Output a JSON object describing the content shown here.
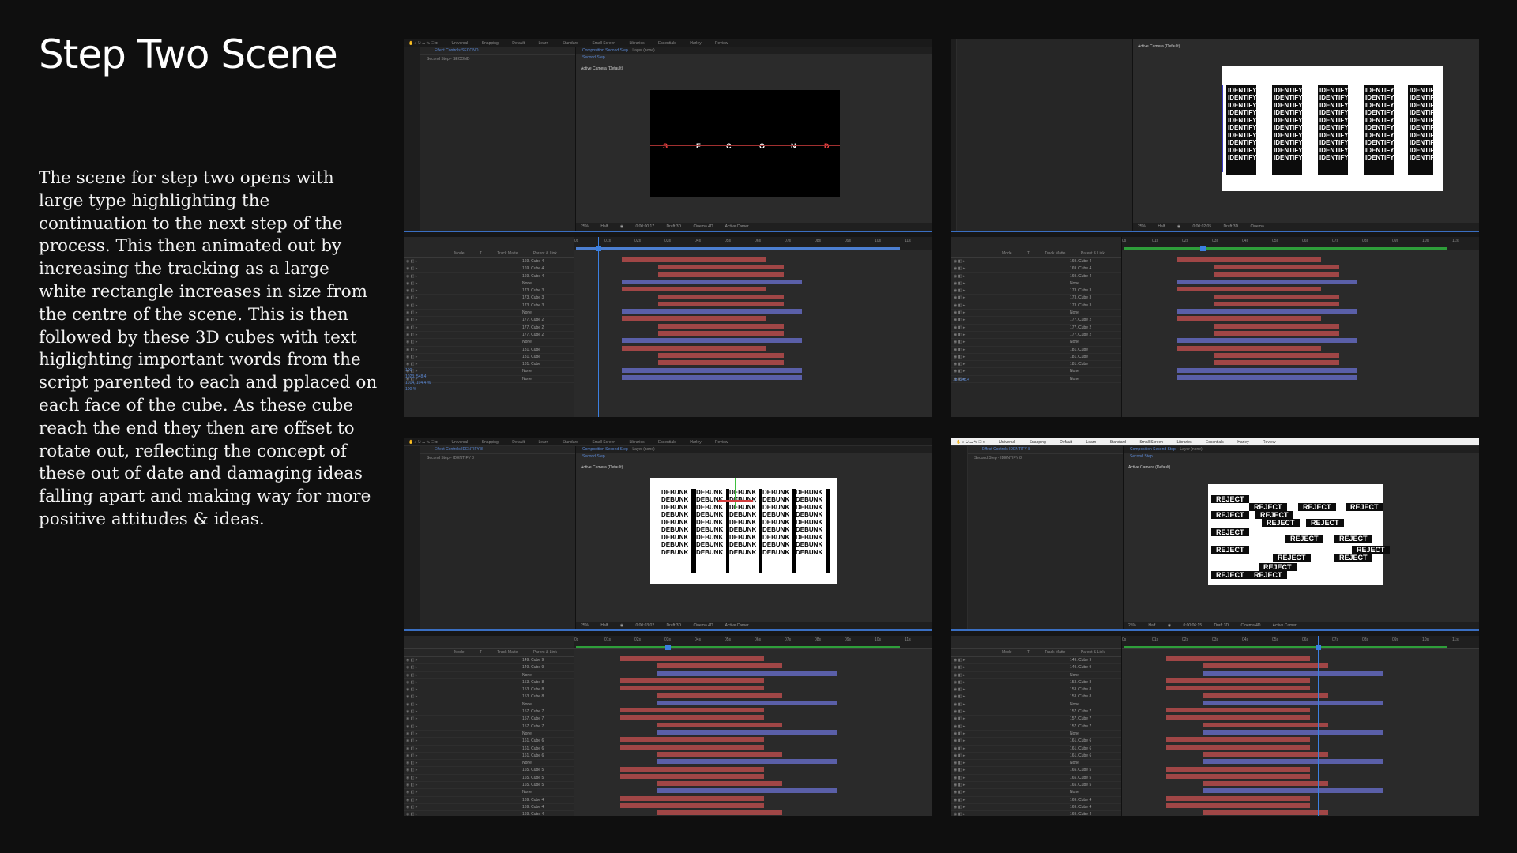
{
  "page": {
    "title": "Step Two Scene",
    "description": "The scene for step two opens with large type highlighting the continuation to the next step of the process. This then animated out by increasing the tracking as a large white rectangle increases in size from the centre of the scene. This is then followed by these 3D cubes with text higlighting important words from the script parented to each and pplaced on each face of the cube. As these cube reach the end they then are offset to rotate out, reflecting the concept of these out of date and damaging ideas falling apart and making way for more positive attitudes & ideas."
  },
  "app": {
    "workspaces": [
      "Default",
      "Learn",
      "Standard",
      "Small Screen",
      "Libraries",
      "Essentials",
      "Harley",
      "Review"
    ],
    "toolbar_extra": [
      "Universal",
      "Snapping"
    ],
    "camera_label": "Active Camera (Default)",
    "columns": [
      "Mode",
      "T",
      "Track Matte",
      "Parent & Link"
    ],
    "time_ticks": [
      "0s",
      "01s",
      "02s",
      "03s",
      "04s",
      "05s",
      "06s",
      "07s",
      "08s",
      "09s",
      "10s",
      "11s"
    ]
  },
  "shots": [
    {
      "effect_controls": "Effect Controls SECOND",
      "effect_sub": "Second Step - SECOND",
      "comp_tab": "Composition Second Step",
      "layer_tab": "Layer (none)",
      "crumb": "Second Step",
      "zoom": "25%",
      "res": "Half",
      "timecode": "0:00:00:17",
      "renderer": "Draft 3D",
      "engine": "Cinema 4D",
      "camera_menu": "Active Camer...",
      "letters": [
        "S",
        "E",
        "C",
        "O",
        "N",
        "D"
      ],
      "layers": [
        "169. Cube 4",
        "169. Cube 4",
        "169. Cube 4",
        "None",
        "173. Cube 3",
        "173. Cube 3",
        "173. Cube 3",
        "None",
        "177. Cube 2",
        "177. Cube 2",
        "177. Cube 2",
        "None",
        "181. Cube",
        "181. Cube",
        "181. Cube",
        "None",
        "None"
      ],
      "readouts": [
        "100",
        "1023, 548.4",
        "1014, 104.4 %",
        "100 %"
      ]
    },
    {
      "zoom": "25%",
      "res": "Half",
      "timecode": "0:00:02:05",
      "renderer": "Draft 3D",
      "engine": "Cinema",
      "word": "IDENTIFY",
      "layers": [
        "169. Cube 4",
        "169. Cube 4",
        "169. Cube 4",
        "None",
        "173. Cube 3",
        "173. Cube 3",
        "173. Cube 3",
        "None",
        "177. Cube 2",
        "177. Cube 2",
        "177. Cube 2",
        "None",
        "181. Cube",
        "181. Cube",
        "181. Cube",
        "None",
        "None"
      ],
      "readouts": [
        "18, 548.4"
      ]
    },
    {
      "effect_controls": "Effect Controls IDENTIFY 8",
      "effect_sub": "Second Step - IDENTIFY 8",
      "comp_tab": "Composition Second Step",
      "layer_tab": "Layer (none)",
      "crumb": "Second Step",
      "zoom": "25%",
      "res": "Half",
      "timecode": "0:00:03:02",
      "renderer": "Draft 3D",
      "engine": "Cinema 4D",
      "camera_menu": "Active Camer...",
      "word": "DEBUNK",
      "layers": [
        "149. Cube 9",
        "149. Cube 9",
        "None",
        "153. Cube 8",
        "153. Cube 8",
        "153. Cube 8",
        "None",
        "157. Cube 7",
        "157. Cube 7",
        "157. Cube 7",
        "None",
        "161. Cube 6",
        "161. Cube 6",
        "161. Cube 6",
        "None",
        "165. Cube 5",
        "165. Cube 5",
        "165. Cube 5",
        "None",
        "169. Cube 4",
        "169. Cube 4",
        "169. Cube 4",
        "None",
        "173. Cube 3"
      ]
    },
    {
      "effect_controls": "Effect Controls IDENTIFY 8",
      "effect_sub": "Second Step - IDENTIFY 8",
      "comp_tab": "Composition Second Step",
      "layer_tab": "Layer (none)",
      "crumb": "Second Step",
      "zoom": "25%",
      "res": "Half",
      "timecode": "0:00:06:15",
      "renderer": "Draft 3D",
      "engine": "Cinema 4D",
      "camera_menu": "Active Camer...",
      "word": "REJECT",
      "layers": [
        "149. Cube 9",
        "149. Cube 9",
        "None",
        "153. Cube 8",
        "153. Cube 8",
        "153. Cube 8",
        "None",
        "157. Cube 7",
        "157. Cube 7",
        "157. Cube 7",
        "None",
        "161. Cube 6",
        "161. Cube 6",
        "161. Cube 6",
        "None",
        "165. Cube 5",
        "165. Cube 5",
        "165. Cube 5",
        "None",
        "169. Cube 4",
        "169. Cube 4",
        "169. Cube 4",
        "None",
        "173. Cube 3"
      ]
    }
  ],
  "colors": {
    "background": "#0f0f0f",
    "bar_red": "#a04646",
    "bar_blue": "#5a5fa8",
    "accent_blue": "#3b7fe0",
    "work_area_green": "#2e9e3a"
  }
}
